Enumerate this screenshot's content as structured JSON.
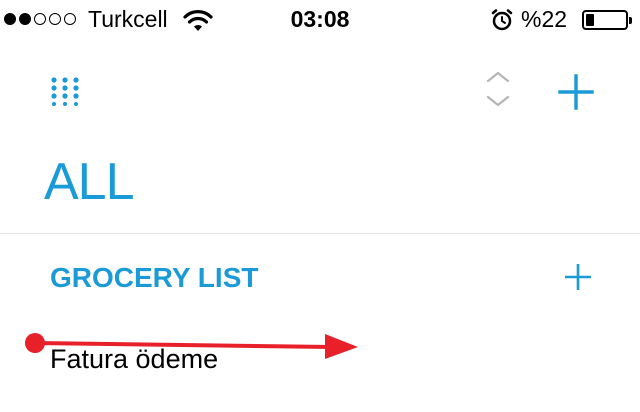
{
  "status_bar": {
    "signal_filled": 2,
    "signal_total": 5,
    "carrier": "Turkcell",
    "time": "03:08",
    "battery_percent": "%22",
    "battery_level": 0.22,
    "icons": [
      "wifi-icon",
      "alarm-clock-icon",
      "battery-icon"
    ]
  },
  "toolbar": {
    "icons": [
      "grid-menu-icon",
      "sort-arrows-icon",
      "add-icon"
    ]
  },
  "page": {
    "title": "ALL"
  },
  "section": {
    "title": "GROCERY LIST",
    "add_icon": "add-icon"
  },
  "items": [
    {
      "label": "Fatura ödeme"
    }
  ],
  "colors": {
    "accent": "#1a9ad6",
    "sort_icon": "#b5b5b5",
    "divider": "#e6e6e6",
    "swipe_gesture": "#e8202a"
  }
}
